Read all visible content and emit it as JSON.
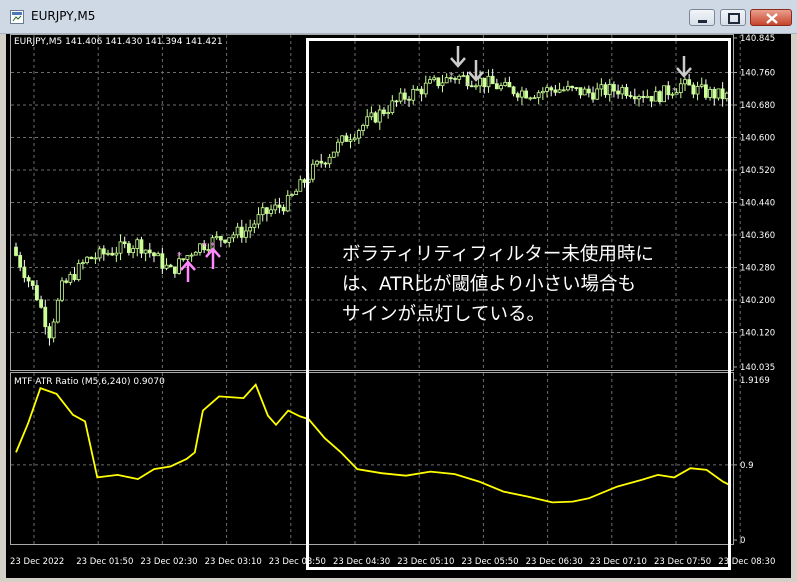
{
  "window": {
    "title": "EURJPY,M5"
  },
  "main_chart": {
    "info_label": "EURJPY,M5  141.406 141.430 141.394 141.421",
    "price_ticks": [
      "140.845",
      "140.760",
      "140.680",
      "140.600",
      "140.520",
      "140.440",
      "140.360",
      "140.280",
      "140.200",
      "140.120",
      "140.035"
    ]
  },
  "indicator": {
    "info_label": "MTF ATR Ratio  (M5,6,240) 0.9070",
    "ticks": [
      "1.9169",
      "0.9",
      "0"
    ],
    "line_color": "#ffff00"
  },
  "time_axis": {
    "labels": [
      "23 Dec 2022",
      "23 Dec 01:50",
      "23 Dec 02:30",
      "23 Dec 03:10",
      "23 Dec 03:50",
      "23 Dec 04:30",
      "23 Dec 05:10",
      "23 Dec 05:50",
      "23 Dec 06:30",
      "23 Dec 07:10",
      "23 Dec 07:50",
      "23 Dec 08:30"
    ]
  },
  "annotation": {
    "lines": [
      "ボラティリティフィルター未使用時に",
      "は、ATR比が閾値より小さい場合も",
      "サインが点灯している。"
    ]
  },
  "colors": {
    "bull_candle": "#ccff99",
    "bear_candle": "#ffffff",
    "grid": "#6b6b6b",
    "buy_signal": "#ff88ff",
    "sell_signal": "#cccccc"
  }
}
